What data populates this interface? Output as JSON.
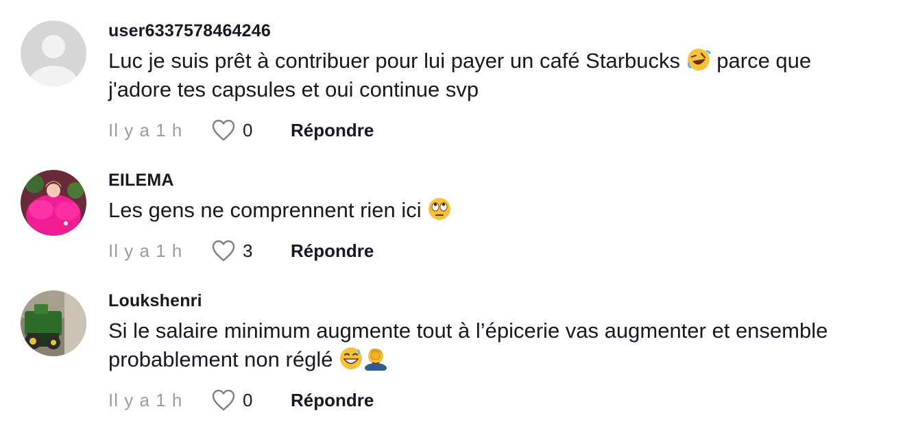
{
  "comments": [
    {
      "username": "user6337578464246",
      "text_line1": "Luc je suis prêt à contribuer pour lui payer un café Starbucks",
      "emoji1": "rolling-on-floor-laughing-emoji",
      "text_line1_after": " parce que",
      "text_line2": "j'adore tes capsules et oui continue svp",
      "time": "Il y a 1 h",
      "likes": "0",
      "reply_label": "Répondre"
    },
    {
      "username": "EILEMA",
      "text_line1": "Les gens ne comprennent rien ici",
      "emoji1": "face-with-rolling-eyes-emoji",
      "time": "Il y a 1 h",
      "likes": "3",
      "reply_label": "Répondre"
    },
    {
      "username": "Loukshenri",
      "text_line1": "Si le salaire minimum augmente tout à l’épicerie vas augmenter et ensemble",
      "text_line2": "probablement non réglé",
      "emoji1": "grinning-face-with-sweat-emoji",
      "emoji2": "person-facepalming-emoji",
      "time": "Il y a 1 h",
      "likes": "0",
      "reply_label": "Répondre"
    }
  ],
  "colors": {
    "text": "#161823",
    "muted": "#9b9ca1",
    "default_avatar_bg": "#d9d9d9"
  }
}
